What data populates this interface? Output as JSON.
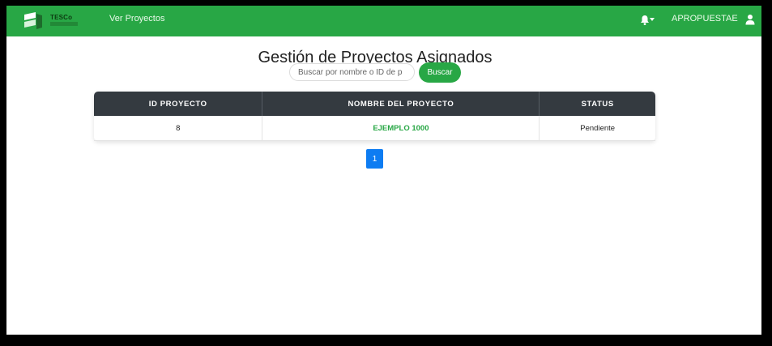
{
  "navbar": {
    "logo_text": "TESCo",
    "link_ver_proyectos": "Ver Proyectos",
    "username": "APROPUESTAE"
  },
  "page": {
    "title": "Gestión de Proyectos Asignados"
  },
  "search": {
    "placeholder": "Buscar por nombre o ID de p",
    "button_label": "Buscar"
  },
  "table": {
    "headers": [
      "ID PROYECTO",
      "NOMBRE DEL PROYECTO",
      "STATUS"
    ],
    "rows": [
      {
        "id": "8",
        "name": "EJEMPLO 1000",
        "status": "Pendiente"
      }
    ]
  },
  "pagination": {
    "current_page": "1"
  },
  "colors": {
    "navbar_bg": "#28a745",
    "table_header_bg": "#343a40",
    "page_button_bg": "#0d7cf2",
    "project_name": "#28a745"
  },
  "icons": {
    "logo": "tesco-logo-icon",
    "notifications": "bell-icon",
    "dropdown": "caret-down-icon",
    "user": "user-icon"
  }
}
